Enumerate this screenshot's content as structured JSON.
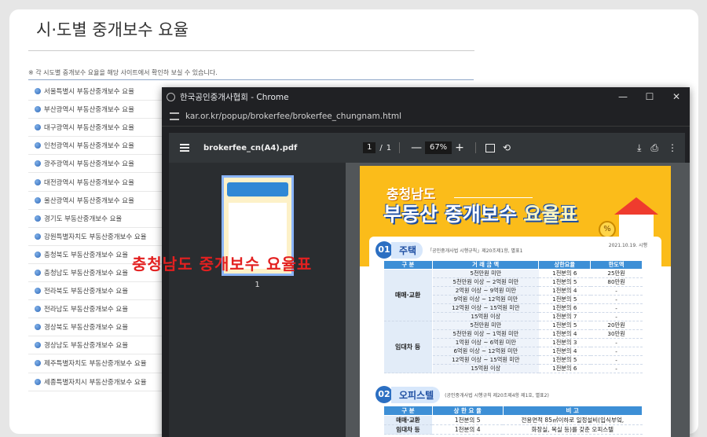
{
  "page": {
    "title": "시·도별 중개보수 요율",
    "notice": "※ 각 시도별 중개보수 요율을 해당 사이트에서 확인하 보실 수 있습니다.",
    "regions": [
      "서울특별시 부동산중개보수 요율",
      "부산광역시 부동산중개보수 요율",
      "대구광역시 부동산중개보수 요율",
      "인천광역시 부동산중개보수 요율",
      "광주광역시 부동산중개보수 요율",
      "대전광역시 부동산중개보수 요율",
      "울산광역시 부동산중개보수 요율",
      "경기도 부동산중개보수 요율",
      "강원특별자치도 부동산중개보수 요율",
      "충청북도 부동산중개보수 요율",
      "충청남도 부동산중개보수 요율",
      "전라북도 부동산중개보수 요율",
      "전라남도 부동산중개보수 요율",
      "경상북도 부동산중개보수 요율",
      "경상남도 부동산중개보수 요율",
      "제주특별자치도 부동산중개보수 요율",
      "세종특별자치시 부동산중개보수 요율"
    ],
    "overlay_text": "충청남도 중개보수 요율표"
  },
  "chrome": {
    "window_title": "한국공인중개사협회 - Chrome",
    "url": "kar.or.kr/popup/brokerfee/brokerfee_chungnam.html",
    "controls": {
      "minimize": "—",
      "maximize": "☐",
      "close": "✕"
    }
  },
  "pdf": {
    "filename": "brokerfee_cn(A4).pdf",
    "page_current": "1",
    "page_sep": "/",
    "page_total": "1",
    "zoom_minus": "—",
    "zoom": "67%",
    "zoom_plus": "+",
    "thumb_page": "1",
    "icons": {
      "download": "⤓",
      "print": "⎙",
      "more": "⋮",
      "rotate": "⟲"
    }
  },
  "doc": {
    "region": "충청남도",
    "title_a": "부동산 중개보수 ",
    "title_b": "요율표",
    "date": "2021.10.19. 시행",
    "coin_symbol": "%",
    "section1": {
      "num": "01",
      "label": "주택",
      "ref": "「공인중개사법 시행규칙」제20조제1항, 별표1",
      "headers": [
        "구 분",
        "거 래 금 액",
        "상한요율",
        "한도액"
      ],
      "groups": [
        {
          "name": "매매·교환",
          "rows": [
            [
              "5천만원 미만",
              "1천분의 6",
              "25만원"
            ],
            [
              "5천만원 이상 ~ 2억원 미만",
              "1천분의 5",
              "80만원"
            ],
            [
              "2억원 이상 ~ 9억원 미만",
              "1천분의 4",
              "-"
            ],
            [
              "9억원 이상 ~ 12억원 미만",
              "1천분의 5",
              "-"
            ],
            [
              "12억원 이상 ~ 15억원 미만",
              "1천분의 6",
              "-"
            ],
            [
              "15억원 이상",
              "1천분의 7",
              "-"
            ]
          ]
        },
        {
          "name": "임대차 등",
          "rows": [
            [
              "5천만원 미만",
              "1천분의 5",
              "20만원"
            ],
            [
              "5천만원 이상 ~ 1억원 미만",
              "1천분의 4",
              "30만원"
            ],
            [
              "1억원 이상 ~ 6억원 미만",
              "1천분의 3",
              "-"
            ],
            [
              "6억원 이상 ~ 12억원 미만",
              "1천분의 4",
              "-"
            ],
            [
              "12억원 이상 ~ 15억원 미만",
              "1천분의 5",
              "-"
            ],
            [
              "15억원 이상",
              "1천분의 6",
              "-"
            ]
          ]
        }
      ]
    },
    "section2": {
      "num": "02",
      "label": "오피스텔",
      "ref": "(공인중개사법 시행규칙 제20조제4항 제1호, 별표2)",
      "headers": [
        "구 분",
        "상 한 요 율",
        "비 고"
      ],
      "rows": [
        [
          "매매·교환",
          "1천분의 5",
          "전용면적 85㎡이하로 일정설비(입식부엌,"
        ],
        [
          "임대차 등",
          "1천분의 4",
          "화장실, 목실 등)를 갖춘 오피스텔"
        ]
      ]
    }
  }
}
